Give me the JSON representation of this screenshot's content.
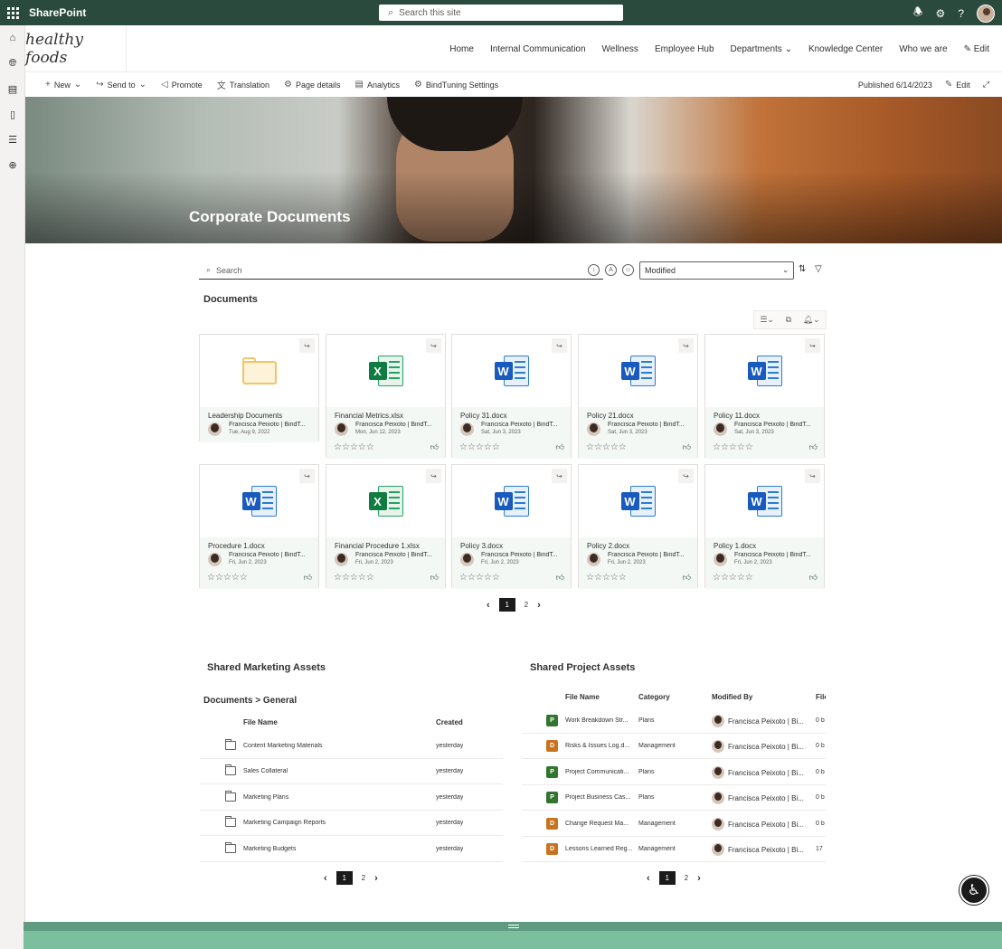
{
  "suite": {
    "brand": "SharePoint",
    "search_placeholder": "Search this site"
  },
  "site": {
    "logo_text": "healthy foods",
    "nav": [
      "Home",
      "Internal Communication",
      "Wellness",
      "Employee Hub",
      "Departments",
      "Knowledge Center",
      "Who we are",
      "Edit"
    ]
  },
  "commands": {
    "new": "New",
    "send_to": "Send to",
    "promote": "Promote",
    "translation": "Translation",
    "page_details": "Page details",
    "analytics": "Analytics",
    "bindtuning": "BindTuning Settings",
    "published": "Published 6/14/2023",
    "edit": "Edit"
  },
  "hero": {
    "title": "Corporate Documents"
  },
  "doc_search": {
    "placeholder": "Search",
    "sort_value": "Modified"
  },
  "documents": {
    "title": "Documents",
    "items": [
      {
        "name": "Leadership Documents",
        "type": "folder",
        "author": "Francisca Peixoto | BindT...",
        "date": "Tue, Aug 9, 2022"
      },
      {
        "name": "Financial Metrics.xlsx",
        "type": "xlsx",
        "author": "Francisca Peixoto | BindT...",
        "date": "Mon, Jun 12, 2023"
      },
      {
        "name": "Policy 31.docx",
        "type": "docx",
        "author": "Francisca Peixoto | BindT...",
        "date": "Sat, Jun 3, 2023"
      },
      {
        "name": "Policy 21.docx",
        "type": "docx",
        "author": "Francisca Peixoto | BindT...",
        "date": "Sat, Jun 3, 2023"
      },
      {
        "name": "Policy 11.docx",
        "type": "docx",
        "author": "Francisca Peixoto | BindT...",
        "date": "Sat, Jun 3, 2023"
      },
      {
        "name": "Procedure 1.docx",
        "type": "docx",
        "author": "Francisca Peixoto | BindT...",
        "date": "Fri, Jun 2, 2023"
      },
      {
        "name": "Financial Procedure 1.xlsx",
        "type": "xlsx",
        "author": "Francisca Peixoto | BindT...",
        "date": "Fri, Jun 2, 2023"
      },
      {
        "name": "Policy 3.docx",
        "type": "docx",
        "author": "Francisca Peixoto | BindT...",
        "date": "Fri, Jun 2, 2023"
      },
      {
        "name": "Policy 2.docx",
        "type": "docx",
        "author": "Francisca Peixoto | BindT...",
        "date": "Fri, Jun 2, 2023"
      },
      {
        "name": "Policy 1.docx",
        "type": "docx",
        "author": "Francisca Peixoto | BindT...",
        "date": "Fri, Jun 2, 2023"
      }
    ],
    "pager": {
      "current": "1",
      "next": "2"
    }
  },
  "marketing": {
    "title": "Shared Marketing Assets",
    "breadcrumb": "Documents > General",
    "col_name": "File Name",
    "col_created": "Created",
    "rows": [
      {
        "name": "Content Marketing Materials",
        "created": "yesterday"
      },
      {
        "name": "Sales Collateral",
        "created": "yesterday"
      },
      {
        "name": "Marketing Plans",
        "created": "yesterday"
      },
      {
        "name": "Marketing Campaign Reports",
        "created": "yesterday"
      },
      {
        "name": "Marketing Budgets",
        "created": "yesterday"
      }
    ],
    "pager": {
      "current": "1",
      "next": "2"
    }
  },
  "project": {
    "title": "Shared Project Assets",
    "col_name": "File Name",
    "col_category": "Category",
    "col_modified": "Modified By",
    "col_file": "File",
    "rows": [
      {
        "name": "Work Breakdown Str...",
        "category": "Plans",
        "modified": "Francisca Peixoto | Bi...",
        "size": "0 b",
        "icon": "proj"
      },
      {
        "name": "Risks & Issues Log.d...",
        "category": "Management",
        "modified": "Francisca Peixoto | Bi...",
        "size": "0 b",
        "icon": "doc"
      },
      {
        "name": "Project Communicati...",
        "category": "Plans",
        "modified": "Francisca Peixoto | Bi...",
        "size": "0 b",
        "icon": "proj"
      },
      {
        "name": "Project Business Cas...",
        "category": "Plans",
        "modified": "Francisca Peixoto | Bi...",
        "size": "0 b",
        "icon": "proj"
      },
      {
        "name": "Change Request Ma...",
        "category": "Management",
        "modified": "Francisca Peixoto | Bi...",
        "size": "0 b",
        "icon": "doc"
      },
      {
        "name": "Lessons Learned Reg...",
        "category": "Management",
        "modified": "Francisca Peixoto | Bi...",
        "size": "17",
        "icon": "doc"
      }
    ],
    "pager": {
      "current": "1",
      "next": "2"
    }
  },
  "colors": {
    "suitebar": "#2b4a3e",
    "footer": "#7bbf9f",
    "excel": "#107c41",
    "word": "#185abd",
    "folder": "#f2c466"
  }
}
